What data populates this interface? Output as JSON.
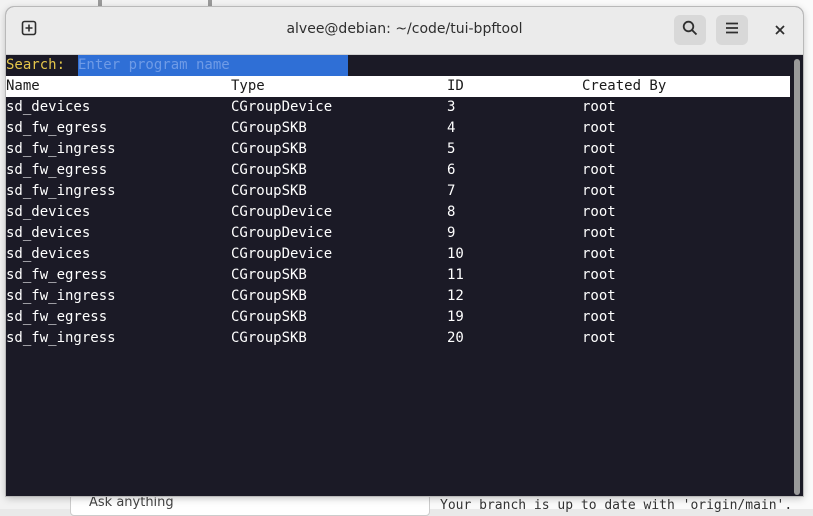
{
  "window": {
    "title": "alvee@debian: ~/code/tui-bpftool",
    "icons": [
      "new-tab-icon",
      "search-icon",
      "hamburger-menu-icon",
      "close-icon"
    ]
  },
  "search": {
    "label": "Search:",
    "placeholder": "Enter program name"
  },
  "table": {
    "headers": [
      "Name",
      "Type",
      "ID",
      "Created By"
    ],
    "rows": [
      [
        "sd_devices",
        "CGroupDevice",
        "3",
        "root"
      ],
      [
        "sd_fw_egress",
        "CGroupSKB",
        "4",
        "root"
      ],
      [
        "sd_fw_ingress",
        "CGroupSKB",
        "5",
        "root"
      ],
      [
        "sd_fw_egress",
        "CGroupSKB",
        "6",
        "root"
      ],
      [
        "sd_fw_ingress",
        "CGroupSKB",
        "7",
        "root"
      ],
      [
        "sd_devices",
        "CGroupDevice",
        "8",
        "root"
      ],
      [
        "sd_devices",
        "CGroupDevice",
        "9",
        "root"
      ],
      [
        "sd_devices",
        "CGroupDevice",
        "10",
        "root"
      ],
      [
        "sd_fw_egress",
        "CGroupSKB",
        "11",
        "root"
      ],
      [
        "sd_fw_ingress",
        "CGroupSKB",
        "12",
        "root"
      ],
      [
        "sd_fw_egress",
        "CGroupSKB",
        "19",
        "root"
      ],
      [
        "sd_fw_ingress",
        "CGroupSKB",
        "20",
        "root"
      ]
    ]
  },
  "background": {
    "ask_placeholder": "Ask anything",
    "status_line": "Your branch is up to date with 'origin/main'."
  },
  "colors": {
    "terminal_bg": "#1b1a26",
    "search_label": "#e3c54a",
    "search_box": "#2f6fd6",
    "header_bg": "#ffffff"
  }
}
